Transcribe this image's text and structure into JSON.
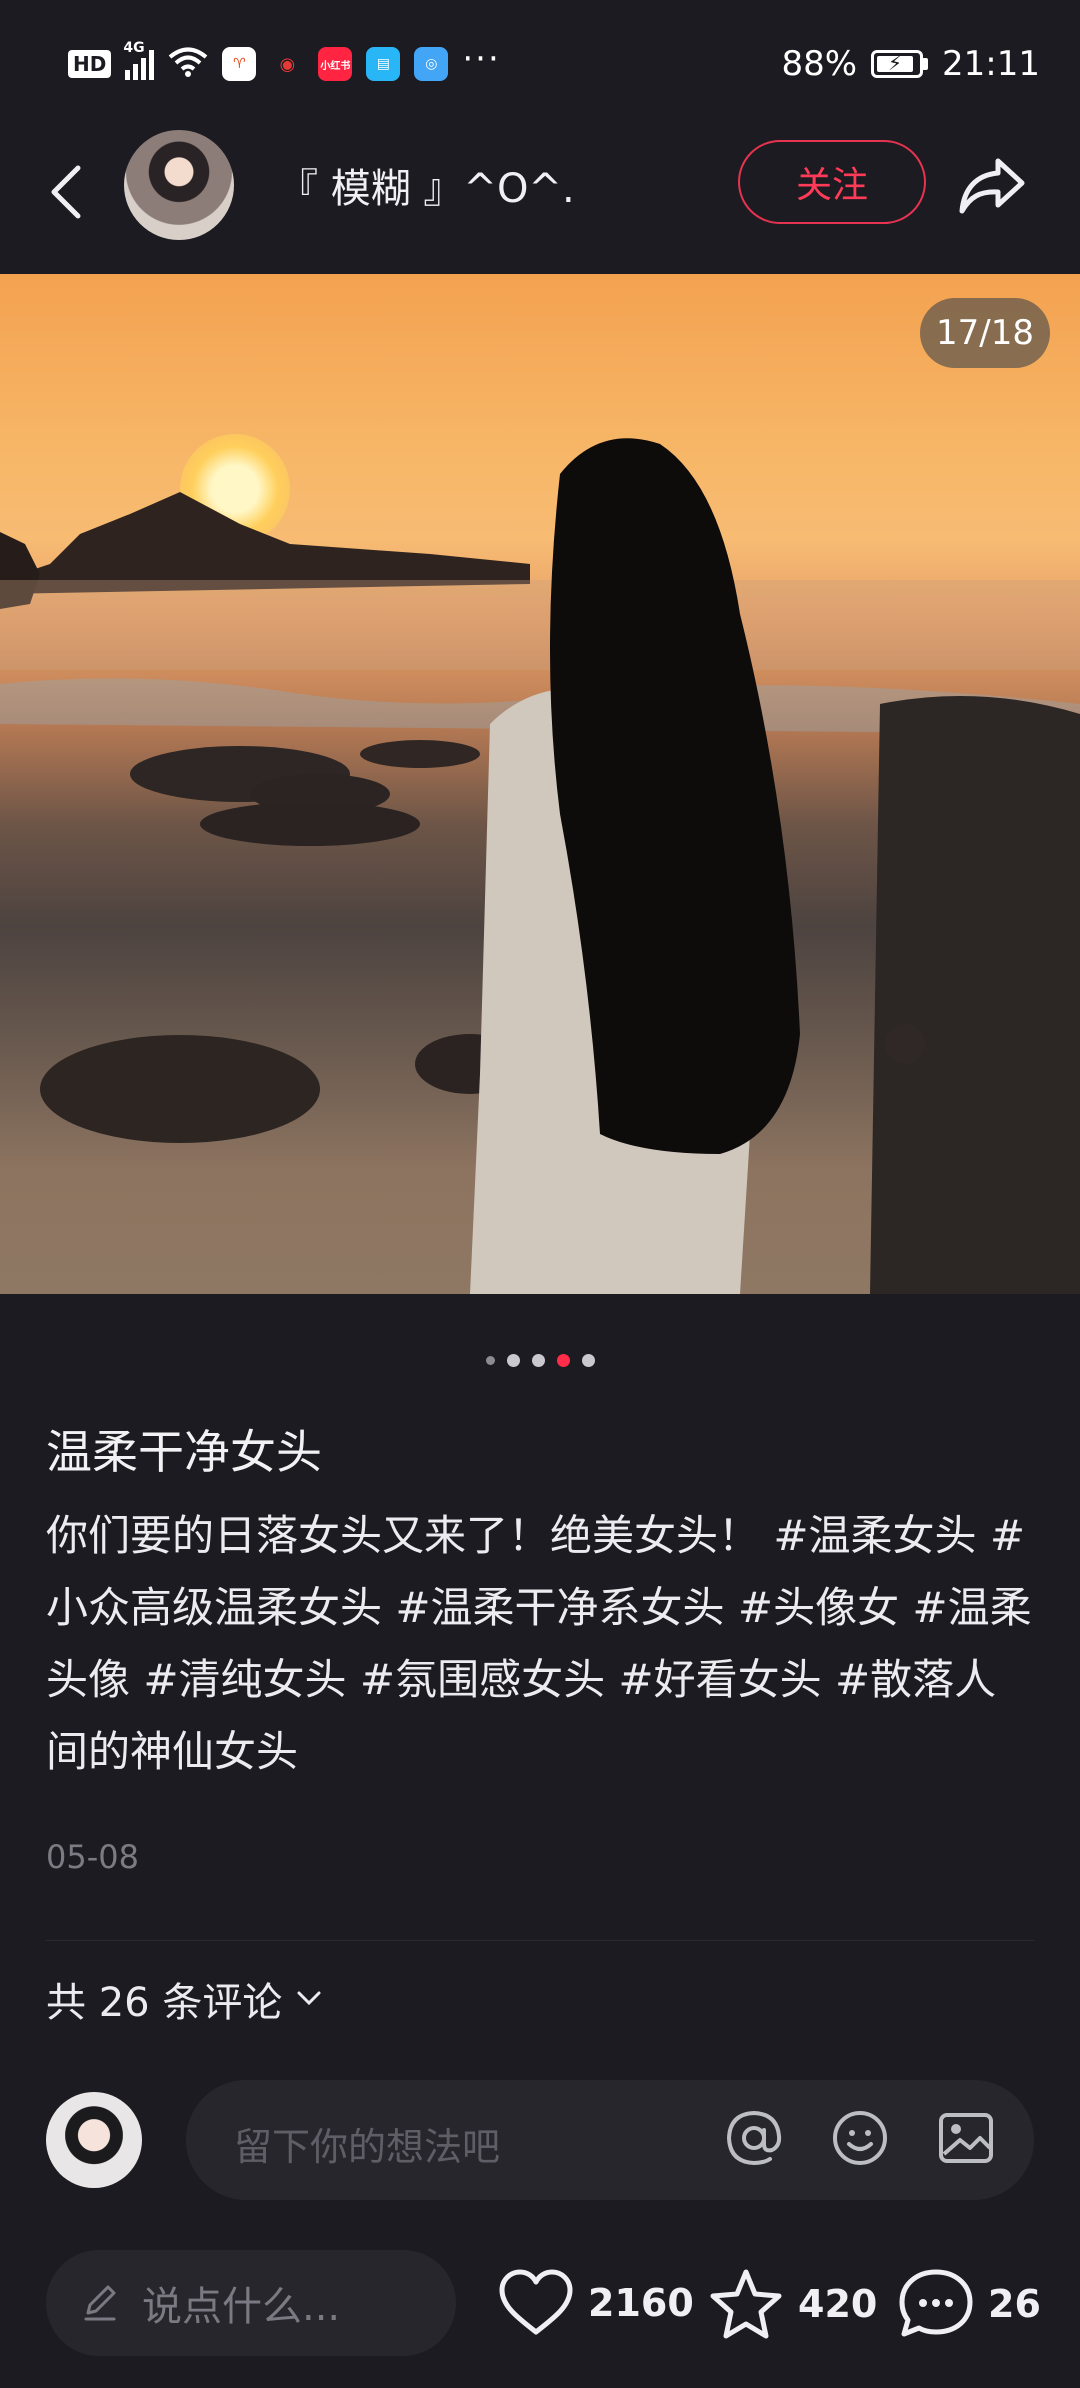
{
  "status_bar": {
    "hd": "HD",
    "network": "4G",
    "battery": "88%",
    "time": "21:11",
    "app_icons": [
      {
        "name": "app-icon-orange",
        "color": "#e64a19",
        "glyph": "♈"
      },
      {
        "name": "app-icon-small",
        "color": "#c62828",
        "glyph": "◉"
      },
      {
        "name": "xiaohongshu-icon",
        "color": "#ff2442",
        "glyph": "小红书"
      },
      {
        "name": "reader-icon",
        "color": "#29b6f6",
        "glyph": "▤"
      },
      {
        "name": "browser-icon",
        "color": "#42a5f5",
        "glyph": "◎"
      }
    ],
    "more": "···"
  },
  "header": {
    "author": "『 模糊 』^O^.",
    "follow_label": "关注"
  },
  "image": {
    "pager": "17/18"
  },
  "post": {
    "title": "温柔干净女头",
    "description": "你们要的日落女头又来了！绝美女头！ #温柔女头 #小众高级温柔女头 #温柔干净系女头 #头像女 #温柔头像 #清纯女头 #氛围感女头 #好看女头 #散落人间的神仙女头",
    "date": "05-08",
    "comment_count": "共 26 条评论"
  },
  "comment_input": {
    "placeholder": "留下你的想法吧"
  },
  "bottom_bar": {
    "say_placeholder": "说点什么...",
    "likes": "2160",
    "stars": "420",
    "comments": "26"
  },
  "colors": {
    "accent": "#ff2d4a",
    "background": "#1c1b21",
    "surface": "#27262d"
  }
}
